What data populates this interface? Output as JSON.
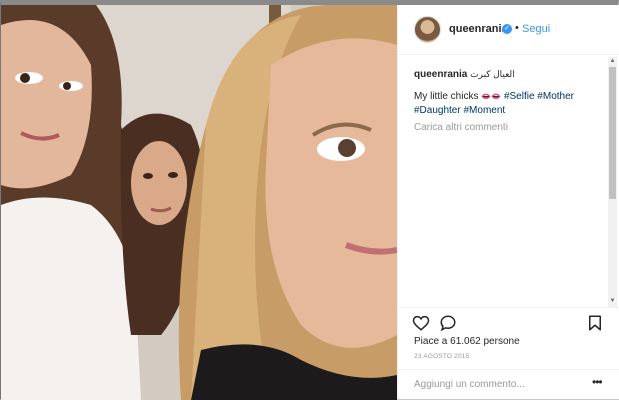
{
  "post": {
    "username": "queenrania",
    "verified_icon": "check-icon",
    "separator": "•",
    "follow_label": "Segui"
  },
  "caption": {
    "username": "queenrania",
    "arabic_text": "العيال كبرت",
    "text": "My little chicks",
    "emoji": "👄👄",
    "hashtags": [
      "#Selfie",
      "#Mother",
      "#Daughter",
      "#Moment"
    ],
    "more_comments": "Carica altri commenti"
  },
  "actions": {
    "like_icon": "heart-icon",
    "comment_icon": "comment-bubble-icon",
    "save_icon": "bookmark-icon",
    "likes_text": "Piace a 61.062 persone",
    "date": "23 AGOSTO 2015"
  },
  "comment_box": {
    "placeholder": "Aggiungi un commento...",
    "options_label": "•••"
  },
  "colors": {
    "link": "#3897f0",
    "hashtag": "#003569",
    "muted": "#999999",
    "text": "#262626"
  }
}
